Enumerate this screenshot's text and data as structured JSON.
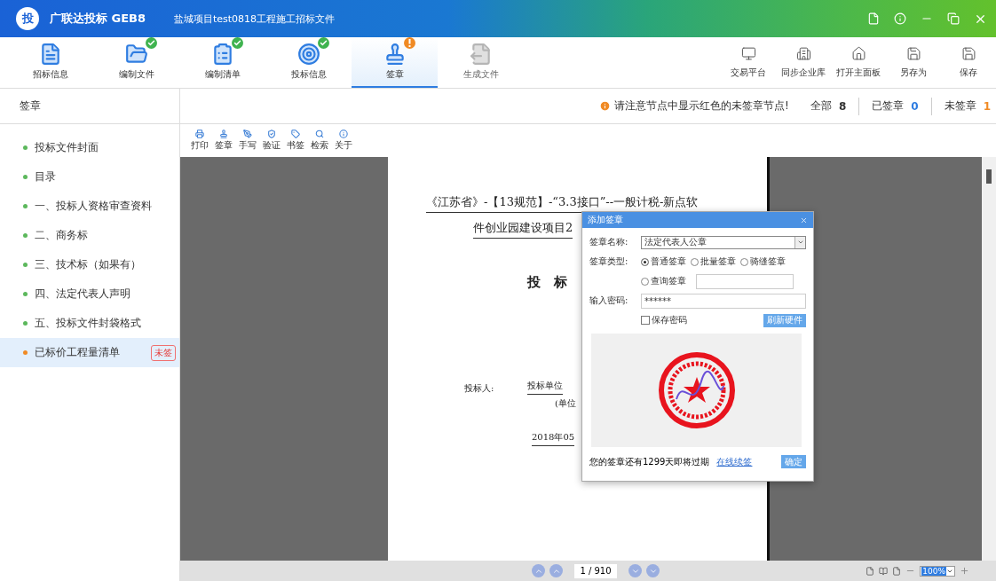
{
  "window": {
    "logo_text": "投",
    "app_name": "广联达投标 GEB8",
    "title": "盐城项目test0818工程施工招标文件"
  },
  "tabs": [
    {
      "label": "招标信息",
      "selected": false,
      "done": false,
      "warning": false,
      "disabled": false
    },
    {
      "label": "编制文件",
      "selected": false,
      "done": true,
      "warning": false,
      "disabled": false
    },
    {
      "label": "编制清单",
      "selected": false,
      "done": true,
      "warning": false,
      "disabled": false
    },
    {
      "label": "投标信息",
      "selected": false,
      "done": true,
      "warning": false,
      "disabled": false
    },
    {
      "label": "签章",
      "selected": true,
      "done": false,
      "warning": true,
      "disabled": false
    },
    {
      "label": "生成文件",
      "selected": false,
      "done": false,
      "warning": false,
      "disabled": true
    }
  ],
  "actions": [
    "交易平台",
    "同步企业库",
    "打开主面板",
    "另存为",
    "保存"
  ],
  "section_title": "签章",
  "notice": "请注意节点中显示红色的未签章节点!",
  "counts": [
    {
      "label": "全部",
      "value": "8",
      "color": "#333333"
    },
    {
      "label": "已签章",
      "value": "0",
      "color": "#2f7de1"
    },
    {
      "label": "未签章",
      "value": "1",
      "color": "#f08a24"
    }
  ],
  "sidebar": {
    "items": [
      {
        "label": "投标文件封面",
        "selected": false,
        "color": "#5cb85c"
      },
      {
        "label": "目录",
        "selected": false,
        "color": "#5cb85c"
      },
      {
        "label": "一、投标人资格审查资料",
        "selected": false,
        "color": "#5cb85c"
      },
      {
        "label": "二、商务标",
        "selected": false,
        "color": "#5cb85c"
      },
      {
        "label": "三、技术标（如果有）",
        "selected": false,
        "color": "#5cb85c"
      },
      {
        "label": "四、法定代表人声明",
        "selected": false,
        "color": "#5cb85c"
      },
      {
        "label": "五、投标文件封袋格式",
        "selected": false,
        "color": "#5cb85c"
      },
      {
        "label": "已标价工程量清单",
        "selected": true,
        "color": "#f08a24",
        "badge": "未签"
      }
    ]
  },
  "pdf_toolbar": [
    "打印",
    "签章",
    "手写",
    "验证",
    "书签",
    "检索",
    "关于"
  ],
  "document": {
    "title_line_1": "《江苏省》-【13规范】-“3.3接口”--一般计税-新点软",
    "title_line_2": "件创业园建设项目2",
    "heading": "投　标",
    "bidder_label": "投标人:",
    "bidder_value": "投标单位",
    "bidder_note": "(单位",
    "date": "2018年05"
  },
  "pager": {
    "page": "1 / 910",
    "zoom": "100%"
  },
  "dialog": {
    "title": "添加签章",
    "name_label": "签章名称:",
    "name_value": "法定代表人公章",
    "type_label": "签章类型:",
    "types": [
      {
        "label": "普通签章",
        "selected": true
      },
      {
        "label": "批量签章",
        "selected": false
      },
      {
        "label": "骑缝签章",
        "selected": false
      },
      {
        "label": "查询签章",
        "selected": false
      }
    ],
    "password_label": "输入密码:",
    "password_value": "******",
    "save_password": {
      "label": "保存密码",
      "checked": false
    },
    "refresh_button": "刷新硬件",
    "expiry": "您的签章还有1299天即将过期",
    "renew_link": "在线续签",
    "ok_button": "确定"
  }
}
